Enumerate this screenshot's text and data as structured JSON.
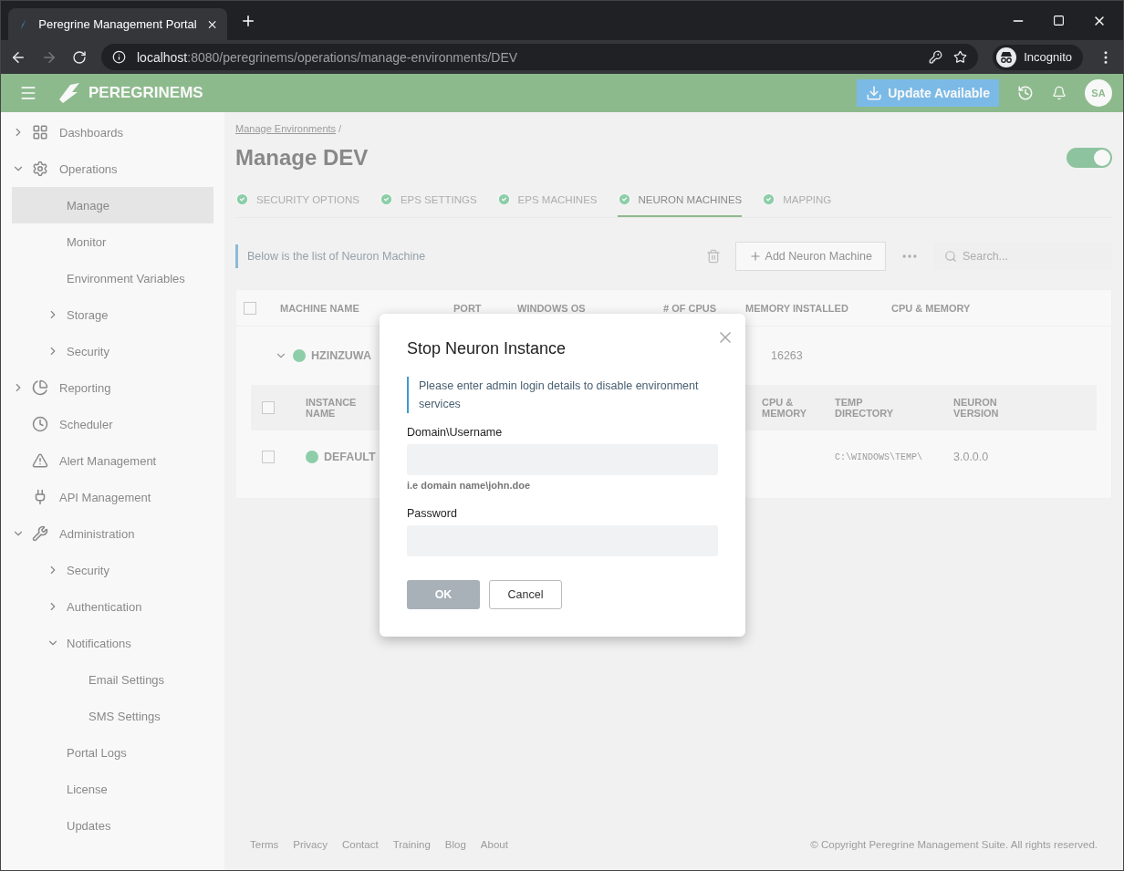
{
  "browser": {
    "tab_title": "Peregrine Management Portal",
    "url_host": "localhost",
    "url_path": ":8080/peregrinems/operations/manage-environments/DEV",
    "profile": "Incognito"
  },
  "header": {
    "logo": "PEREGRINEMS",
    "update_button": "Update Available",
    "avatar": "SA"
  },
  "sidebar": {
    "items": [
      {
        "label": "Dashboards",
        "expanded": false
      },
      {
        "label": "Operations",
        "expanded": true,
        "children": [
          {
            "label": "Manage",
            "selected": true
          },
          {
            "label": "Monitor",
            "selected": false
          },
          {
            "label": "Environment Variables",
            "selected": false
          },
          {
            "label": "Storage",
            "selected": false,
            "expanded": false
          },
          {
            "label": "Security",
            "selected": false,
            "expanded": false
          }
        ]
      },
      {
        "label": "Reporting",
        "expanded": false
      },
      {
        "label": "Scheduler"
      },
      {
        "label": "Alert Management"
      },
      {
        "label": "API Management"
      },
      {
        "label": "Administration",
        "expanded": true,
        "children": [
          {
            "label": "Security",
            "selected": false,
            "expanded": false
          },
          {
            "label": "Authentication",
            "selected": false,
            "expanded": false
          },
          {
            "label": "Notifications",
            "selected": false,
            "expanded": true,
            "children": [
              {
                "label": "Email Settings",
                "selected": false
              },
              {
                "label": "SMS Settings",
                "selected": false
              }
            ]
          },
          {
            "label": "Portal Logs",
            "selected": false
          },
          {
            "label": "License",
            "selected": false
          },
          {
            "label": "Updates",
            "selected": false
          }
        ]
      }
    ]
  },
  "breadcrumb": {
    "link": "Manage Environments",
    "separator": "/"
  },
  "page_title": "Manage DEV",
  "toggle": {
    "on": true
  },
  "tabs": [
    {
      "label": "SECURITY OPTIONS",
      "selected": false
    },
    {
      "label": "EPS SETTINGS",
      "selected": false
    },
    {
      "label": "EPS MACHINES",
      "selected": false
    },
    {
      "label": "NEURON MACHINES",
      "selected": true
    },
    {
      "label": "MAPPING",
      "selected": false
    }
  ],
  "toolbar": {
    "info": "Below is the list of Neuron Machine",
    "add_button": "Add Neuron Machine",
    "search_placeholder": "Search..."
  },
  "table": {
    "columns": [
      "MACHINE NAME",
      "PORT",
      "WINDOWS OS",
      "# OF CPUS",
      "MEMORY INSTALLED",
      "CPU & MEMORY"
    ],
    "select_all_checked": false,
    "row": {
      "machine_name": "HZINZUWA",
      "memory_installed": "16263",
      "expanded": true
    },
    "sub_select_all_checked": false,
    "sub_columns": [
      "INSTANCE NAME",
      "CPU & MEMORY",
      "TEMP DIRECTORY",
      "NEURON VERSION"
    ],
    "sub_row": {
      "checked": false,
      "instance_name": "DEFAULT",
      "temp_directory": "C:\\WINDOWS\\TEMP\\",
      "neuron_version": "3.0.0.0"
    }
  },
  "footer": {
    "links": [
      "Terms",
      "Privacy",
      "Contact",
      "Training",
      "Blog",
      "About"
    ],
    "copyright": "© Copyright Peregrine Management Suite. All rights reserved."
  },
  "dialog": {
    "title": "Stop Neuron Instance",
    "note": "Please enter admin login details to disable environment services",
    "fields": [
      {
        "label": "Domain\\Username",
        "hint": "i.e domain name\\john.doe"
      },
      {
        "label": "Password"
      }
    ],
    "buttons": [
      {
        "label": "OK",
        "kind": "primary",
        "disabled": true
      },
      {
        "label": "Cancel",
        "kind": "secondary",
        "disabled": false
      }
    ]
  }
}
